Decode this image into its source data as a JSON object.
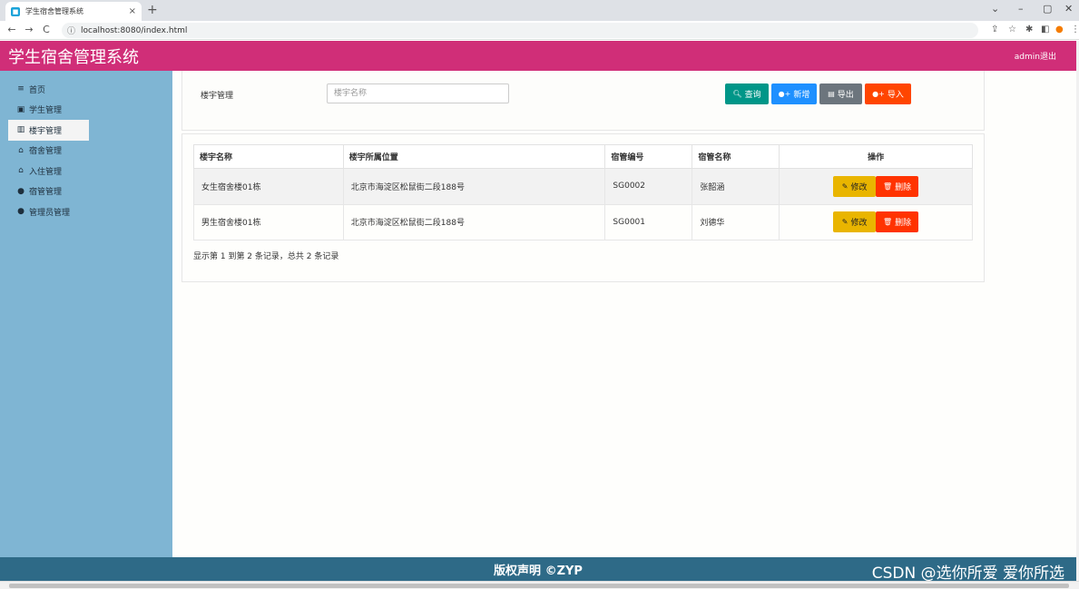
{
  "browser": {
    "tab_title": "学生宿舍管理系统",
    "tab_close": "×",
    "new_tab": "+",
    "url": "localhost:8080/index.html",
    "min": "–",
    "restore": "▢",
    "close": "✕",
    "menu": "⌄"
  },
  "header": {
    "title": "学生宿舍管理系统",
    "admin": "admin退出"
  },
  "sidebar": {
    "items": [
      {
        "label": "首页",
        "icon": "≡"
      },
      {
        "label": "学生管理",
        "icon": "▣"
      },
      {
        "label": "楼宇管理",
        "icon": "▥"
      },
      {
        "label": "宿舍管理",
        "icon": "⌂"
      },
      {
        "label": "入住管理",
        "icon": "⌂"
      },
      {
        "label": "宿管管理",
        "icon": "●"
      },
      {
        "label": "管理员管理",
        "icon": "●"
      }
    ]
  },
  "toolbar": {
    "label": "楼宇管理",
    "search_placeholder": "楼宇名称",
    "query": "查询",
    "add": "新增",
    "export": "导出",
    "import": "导入"
  },
  "table": {
    "headers": [
      "楼宇名称",
      "楼宇所属位置",
      "宿管编号",
      "宿管名称",
      "操作"
    ],
    "rows": [
      [
        "女生宿舍楼01栋",
        "北京市海淀区松鼠街二段188号",
        "SG0002",
        "张韶涵"
      ],
      [
        "男生宿舍楼01栋",
        "北京市海淀区松鼠街二段188号",
        "SG0001",
        "刘德华"
      ]
    ],
    "edit": "修改",
    "delete": "删除",
    "summary": "显示第 1 到第 2 条记录，总共 2 条记录"
  },
  "footer": {
    "text": "版权声明 ©ZYP",
    "watermark": "CSDN @选你所爱 爱你所选"
  }
}
